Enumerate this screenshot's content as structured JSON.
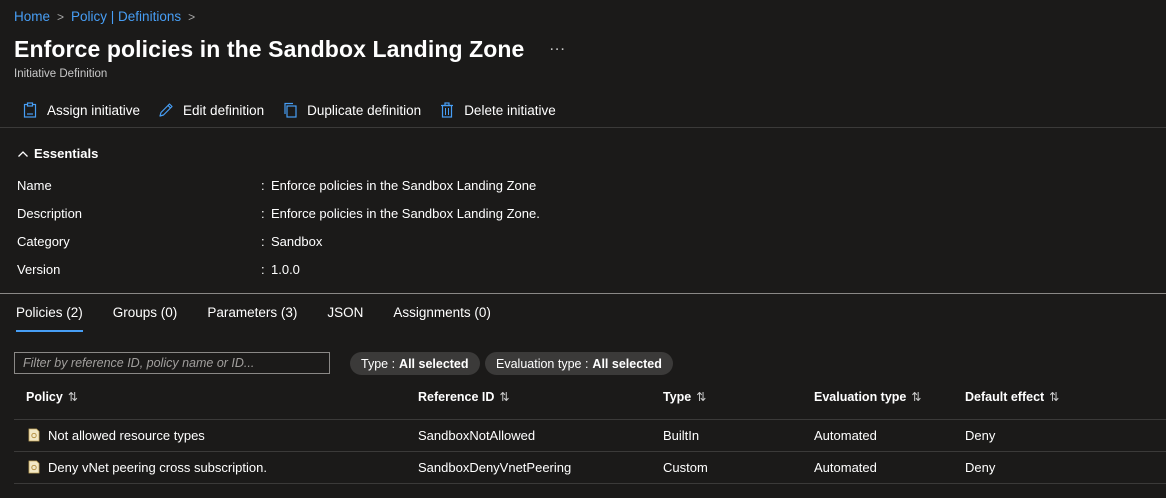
{
  "breadcrumb": {
    "items": [
      "Home",
      "Policy | Definitions"
    ],
    "separator": ">"
  },
  "page": {
    "title": "Enforce policies in the Sandbox Landing Zone",
    "more_label": "...",
    "subtitle": "Initiative Definition"
  },
  "toolbar": {
    "assign_label": "Assign initiative",
    "edit_label": "Edit definition",
    "duplicate_label": "Duplicate definition",
    "delete_label": "Delete initiative"
  },
  "essentials": {
    "title": "Essentials",
    "rows": [
      {
        "label": "Name",
        "value": "Enforce policies in the Sandbox Landing Zone"
      },
      {
        "label": "Description",
        "value": "Enforce policies in the Sandbox Landing Zone."
      },
      {
        "label": "Category",
        "value": "Sandbox"
      },
      {
        "label": "Version",
        "value": "1.0.0"
      }
    ],
    "colon": ":"
  },
  "tabs": [
    {
      "label": "Policies (2)",
      "active": true
    },
    {
      "label": "Groups (0)",
      "active": false
    },
    {
      "label": "Parameters (3)",
      "active": false
    },
    {
      "label": "JSON",
      "active": false
    },
    {
      "label": "Assignments (0)",
      "active": false
    }
  ],
  "filters": {
    "search_placeholder": "Filter by reference ID, policy name or ID...",
    "type_prefix": "Type :",
    "type_value": "All selected",
    "eval_prefix": "Evaluation type :",
    "eval_value": "All selected"
  },
  "table": {
    "columns": [
      "Policy",
      "Reference ID",
      "Type",
      "Evaluation type",
      "Default effect"
    ],
    "sort_glyph": "⇅",
    "rows": [
      {
        "policy": "Not allowed resource types",
        "reference_id": "SandboxNotAllowed",
        "type": "BuiltIn",
        "evaluation_type": "Automated",
        "default_effect": "Deny"
      },
      {
        "policy": "Deny vNet peering cross subscription.",
        "reference_id": "SandboxDenyVnetPeering",
        "type": "Custom",
        "evaluation_type": "Automated",
        "default_effect": "Deny"
      }
    ]
  },
  "colors": {
    "background": "#1b1a19",
    "accent": "#479ef5",
    "divider": "#3b3a39",
    "pill": "#3b3a39"
  },
  "icons": {
    "assign": "clipboard-icon",
    "edit": "pencil-icon",
    "duplicate": "copy-icon",
    "delete": "trash-icon",
    "essentials": "chevron-up-icon",
    "policy_row": "policy-document-icon"
  }
}
